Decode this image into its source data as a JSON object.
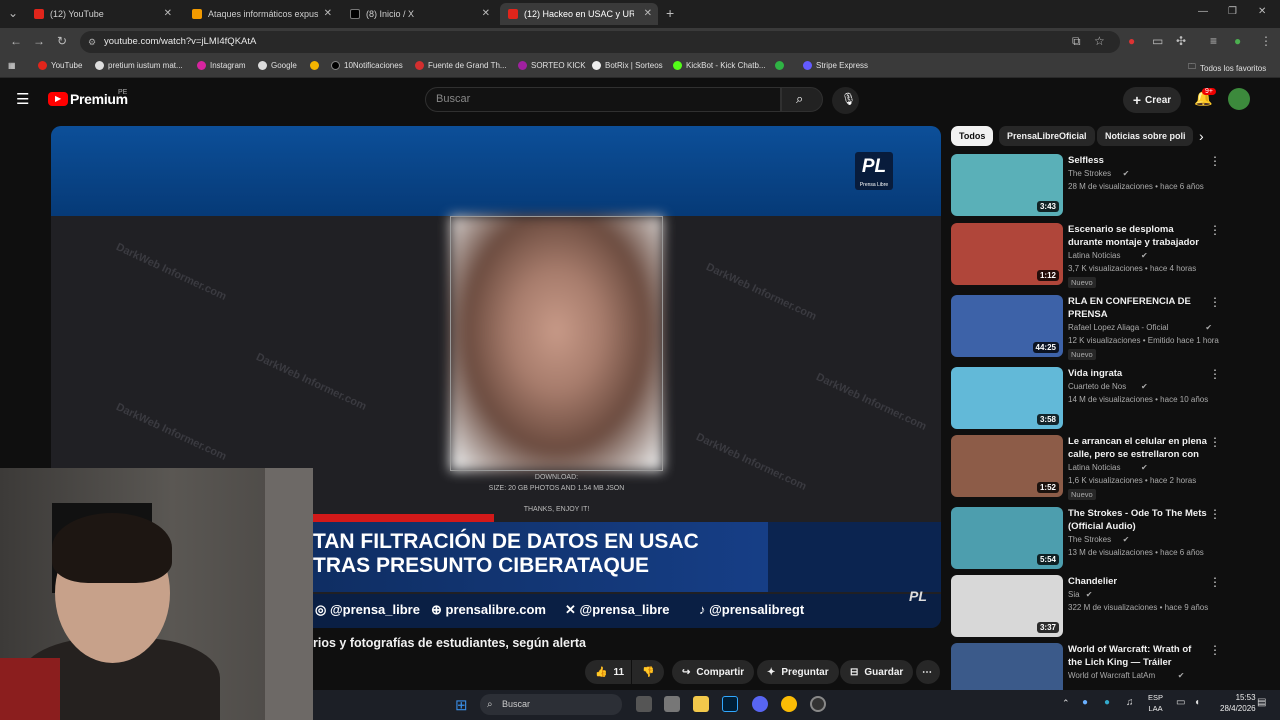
{
  "browser": {
    "tabs": [
      {
        "label": "(12) YouTube",
        "color": "#e1251b"
      },
      {
        "label": "Ataques informáticos expusieron",
        "color": "#f29a00"
      },
      {
        "label": "(8) Inicio / X",
        "color": "#000000"
      },
      {
        "label": "(12) Hackeo en USAC y URL exp",
        "color": "#e1251b"
      }
    ],
    "url": "youtube.com/watch?v=jLMI4fQKAtA",
    "bookmarks": [
      "YouTube",
      "pretium iustum mat...",
      "Instagram",
      "Google",
      "10Notificaciones",
      "Fuente de Grand Th...",
      "SORTEO KICK",
      "BotRix | Sorteos",
      "KickBot - Kick Chatb...",
      "Stripe Express"
    ],
    "all_bookmarks": "Todos los favoritos"
  },
  "youtube": {
    "logo": "Premium",
    "country": "PE",
    "search_placeholder": "Buscar",
    "create_label": "Crear",
    "notifications": "9+"
  },
  "video": {
    "overlay_logo": "PL",
    "overlay_logo_sub": "Prensa Libre",
    "download_line1": "DOWNLOAD:",
    "download_line2": "SIZE: 20 GB PHOTOS AND 1.54 MB JSON",
    "download_line3": "THANKS, ENJOY IT!",
    "headline1": "TAN FILTRACIÓN DE DATOS EN USAC",
    "headline2": "TRAS PRESUNTO CIBERATAQUE",
    "social": [
      "@prensa_libre",
      "prensalibre.com",
      "@prensa_libre",
      "@prensalibregt"
    ],
    "corner_logo": "PL",
    "watermark": "DarkWeb Informer.com",
    "title": "rios y fotografías de estudiantes, según alerta",
    "likes": "11",
    "share": "Compartir",
    "ask": "Preguntar",
    "save": "Guardar"
  },
  "chips": [
    "Todos",
    "PrensaLibreOficial",
    "Noticias sobre poli"
  ],
  "recommendations": [
    {
      "title": "Selfless",
      "channel": "The Strokes",
      "meta": "28 M de visualizaciones • hace 6 años",
      "duration": "3:43",
      "new": "",
      "thumb": "#5ab0b8"
    },
    {
      "title": "Escenario se desploma durante montaje y trabajador muere: A...",
      "channel": "Latina Noticias",
      "meta": "3,7 K visualizaciones • hace 4 horas",
      "duration": "1:12",
      "new": "Nuevo",
      "thumb": "#b0463a"
    },
    {
      "title": "RLA EN CONFERENCIA DE PRENSA",
      "channel": "Rafael Lopez Aliaga - Oficial",
      "meta": "12 K visualizaciones • Emitido hace 1 hora",
      "duration": "44:25",
      "new": "Nuevo",
      "thumb": "#3d62a8"
    },
    {
      "title": "Vida ingrata",
      "channel": "Cuarteto de Nos",
      "meta": "14 M de visualizaciones • hace 10 años",
      "duration": "3:58",
      "new": "",
      "thumb": "#62b9d8"
    },
    {
      "title": "Le arrancan el celular en plena calle, pero se estrellaron con ...",
      "channel": "Latina Noticias",
      "meta": "1,6 K visualizaciones • hace 2 horas",
      "duration": "1:52",
      "new": "Nuevo",
      "thumb": "#8d5c48"
    },
    {
      "title": "The Strokes - Ode To The Mets (Official Audio)",
      "channel": "The Strokes",
      "meta": "13 M de visualizaciones • hace 6 años",
      "duration": "5:54",
      "new": "",
      "thumb": "#4d9eae"
    },
    {
      "title": "Chandelier",
      "channel": "Sia",
      "meta": "322 M de visualizaciones • hace 9 años",
      "duration": "3:37",
      "new": "",
      "thumb": "#d8d8d8"
    },
    {
      "title": "World of Warcraft: Wrath of the Lich King — Tráiler Cinemático",
      "channel": "World of Warcraft LatAm",
      "meta": "",
      "duration": "",
      "new": "",
      "thumb": "#3b5a8a"
    }
  ],
  "taskbar": {
    "search": "Buscar",
    "lang1": "ESP",
    "lang2": "LAA",
    "time": "15:53",
    "date": "28/4/2026"
  }
}
